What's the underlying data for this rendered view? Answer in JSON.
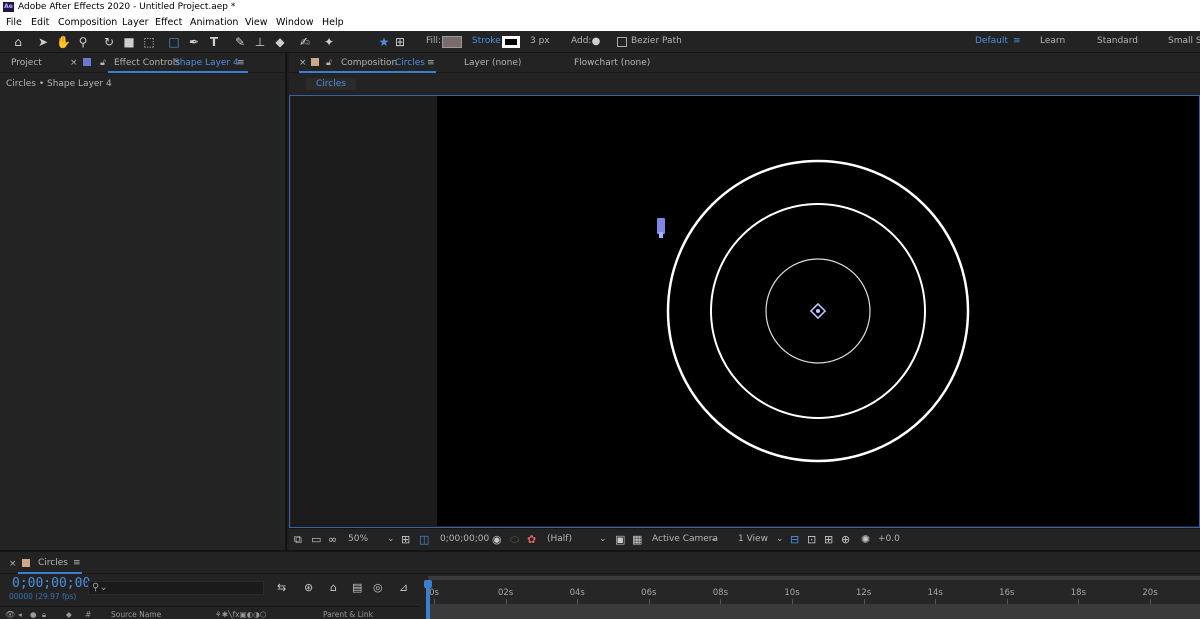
{
  "window": {
    "app_icon_text": "Ae",
    "title": "Adobe After Effects 2020 - Untitled Project.aep *"
  },
  "menu": [
    "File",
    "Edit",
    "Composition",
    "Layer",
    "Effect",
    "Animation",
    "View",
    "Window",
    "Help"
  ],
  "toolbar": {
    "tools": [
      "home-icon",
      "selection-icon",
      "hand-icon",
      "zoom-icon",
      "rotate-icon",
      "camera-icon",
      "pan-behind-icon",
      "rectangle-icon",
      "pen-icon",
      "type-icon",
      "brush-icon",
      "clone-stamp-icon",
      "eraser-icon",
      "roto-brush-icon",
      "puppet-pin-icon"
    ],
    "fill_label": "Fill:",
    "stroke_label": "Stroke",
    "stroke_width": "3 px",
    "add_label": "Add:",
    "bezier_label": "Bezier Path",
    "fill_color": "#7a6b6c",
    "stroke_color": "#ffffff",
    "workspaces": {
      "default": "Default",
      "learn": "Learn",
      "standard": "Standard",
      "small_screen": "Small Se"
    }
  },
  "left_panel": {
    "project_tab": "Project",
    "effect_controls_prefix": "Effect Controls",
    "effect_controls_layer": "Shape Layer 4",
    "breadcrumb": "Circles • Shape Layer 4"
  },
  "comp_panel": {
    "comp_tab_prefix": "Composition",
    "comp_name": "Circles",
    "layer_tab": "Layer  (none)",
    "flowchart_tab": "Flowchart  (none)",
    "breadcrumb": "Circles"
  },
  "viewer_footer": {
    "magnification": "50%",
    "timecode": "0;00;00;00",
    "resolution": "(Half)",
    "camera": "Active Camera",
    "views": "1 View",
    "exposure": "+0.0"
  },
  "timeline": {
    "comp_name": "Circles",
    "timecode": "0;00;00;00",
    "fps": "00000 (29.97 fps)",
    "search_icon": "search-icon",
    "col_source": "Source Name",
    "col_parent": "Parent & Link",
    "ruler_labels": [
      "0s",
      "02s",
      "04s",
      "06s",
      "08s",
      "10s",
      "12s",
      "14s",
      "16s",
      "18s",
      "20s"
    ]
  },
  "accent_color": "#4a90e2"
}
